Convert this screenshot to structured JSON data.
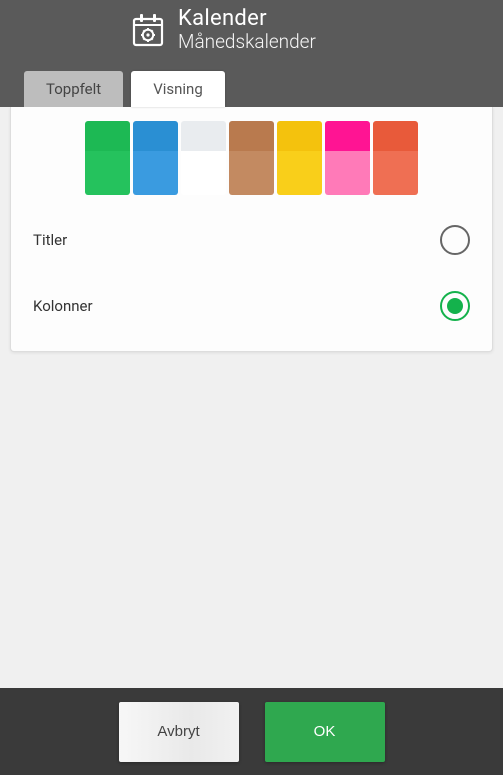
{
  "header": {
    "title": "Kalender",
    "subtitle": "Månedskalender"
  },
  "tabs": {
    "toppfelt": "Toppfelt",
    "visning": "Visning"
  },
  "swatches": [
    {
      "top": "#1db954",
      "bot": "#25c25d"
    },
    {
      "top": "#2a8fd3",
      "bot": "#3a9be0"
    },
    {
      "top": "#e9ecef",
      "bot": "#ffffff"
    },
    {
      "top": "#b97a4e",
      "bot": "#c38a61"
    },
    {
      "top": "#f4c20d",
      "bot": "#f9cf1a"
    },
    {
      "top": "#ff1493",
      "bot": "#ff7ab8"
    },
    {
      "top": "#e85a3a",
      "bot": "#ef6f53"
    }
  ],
  "options": {
    "titler_label": "Titler",
    "titler_checked": false,
    "kolonner_label": "Kolonner",
    "kolonner_checked": true
  },
  "footer": {
    "cancel": "Avbryt",
    "ok": "OK"
  }
}
